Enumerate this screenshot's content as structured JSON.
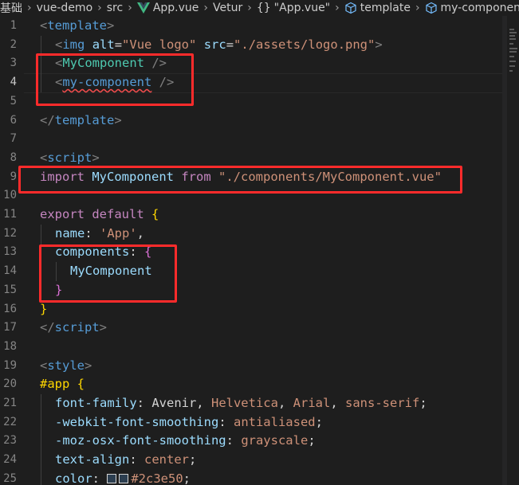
{
  "breadcrumb": {
    "items": [
      {
        "label": "基础",
        "icon": null
      },
      {
        "label": "vue-demo",
        "icon": null
      },
      {
        "label": "src",
        "icon": null
      },
      {
        "label": "App.vue",
        "icon": "vue-icon"
      },
      {
        "label": "Vetur",
        "icon": null
      },
      {
        "label": "\"App.vue\"",
        "icon": "braces-icon"
      },
      {
        "label": "template",
        "icon": "cube-icon"
      },
      {
        "label": "my-component",
        "icon": "cube-icon"
      }
    ],
    "separator": "›"
  },
  "editor": {
    "active_line": 4,
    "lines": [
      {
        "n": "1",
        "indent": 0,
        "tokens": [
          [
            "t-punc",
            "<"
          ],
          [
            "t-tag",
            "template"
          ],
          [
            "t-punc",
            ">"
          ]
        ]
      },
      {
        "n": "2",
        "indent": 1,
        "tokens": [
          [
            "t-punc",
            "<"
          ],
          [
            "t-tag",
            "img"
          ],
          [
            "t-text",
            " "
          ],
          [
            "t-attr",
            "alt"
          ],
          [
            "t-text",
            "="
          ],
          [
            "t-str",
            "\"Vue logo\""
          ],
          [
            "t-text",
            " "
          ],
          [
            "t-attr",
            "src"
          ],
          [
            "t-text",
            "="
          ],
          [
            "t-str",
            "\"./assets/logo.png\""
          ],
          [
            "t-punc",
            ">"
          ]
        ]
      },
      {
        "n": "3",
        "indent": 1,
        "tokens": [
          [
            "t-punc",
            "<"
          ],
          [
            "t-comp",
            "MyComponent"
          ],
          [
            "t-text",
            " "
          ],
          [
            "t-punc",
            "/>"
          ]
        ]
      },
      {
        "n": "4",
        "indent": 1,
        "tokens": [
          [
            "t-punc",
            "<"
          ],
          [
            "t-tag squiggle",
            "my-component"
          ],
          [
            "t-text",
            " "
          ],
          [
            "t-punc",
            "/>"
          ]
        ]
      },
      {
        "n": "5",
        "indent": 0,
        "tokens": []
      },
      {
        "n": "6",
        "indent": 0,
        "tokens": [
          [
            "t-punc",
            "</"
          ],
          [
            "t-tag",
            "template"
          ],
          [
            "t-punc",
            ">"
          ]
        ]
      },
      {
        "n": "7",
        "indent": 0,
        "tokens": []
      },
      {
        "n": "8",
        "indent": 0,
        "tokens": [
          [
            "t-punc",
            "<"
          ],
          [
            "t-tag",
            "script"
          ],
          [
            "t-punc",
            ">"
          ]
        ]
      },
      {
        "n": "9",
        "indent": 0,
        "tokens": [
          [
            "t-kw",
            "import"
          ],
          [
            "t-text",
            " "
          ],
          [
            "t-var",
            "MyComponent"
          ],
          [
            "t-text",
            " "
          ],
          [
            "t-kw",
            "from"
          ],
          [
            "t-text",
            " "
          ],
          [
            "t-str",
            "\"./components/MyComponent.vue\""
          ]
        ]
      },
      {
        "n": "10",
        "indent": 0,
        "tokens": []
      },
      {
        "n": "11",
        "indent": 0,
        "tokens": [
          [
            "t-kw",
            "export"
          ],
          [
            "t-text",
            " "
          ],
          [
            "t-kw",
            "default"
          ],
          [
            "t-text",
            " "
          ],
          [
            "t-brace1",
            "{"
          ]
        ]
      },
      {
        "n": "12",
        "indent": 1,
        "tokens": [
          [
            "t-var",
            "name"
          ],
          [
            "t-text",
            ": "
          ],
          [
            "t-str",
            "'App'"
          ],
          [
            "t-text",
            ","
          ]
        ]
      },
      {
        "n": "13",
        "indent": 1,
        "tokens": [
          [
            "t-var",
            "components"
          ],
          [
            "t-text",
            ": "
          ],
          [
            "t-brace2",
            "{"
          ]
        ]
      },
      {
        "n": "14",
        "indent": 2,
        "tokens": [
          [
            "t-var",
            "MyComponent"
          ]
        ]
      },
      {
        "n": "15",
        "indent": 1,
        "tokens": [
          [
            "t-brace2",
            "}"
          ]
        ]
      },
      {
        "n": "16",
        "indent": 0,
        "tokens": [
          [
            "t-brace1",
            "}"
          ]
        ]
      },
      {
        "n": "17",
        "indent": 0,
        "tokens": [
          [
            "t-punc",
            "</"
          ],
          [
            "t-tag",
            "script"
          ],
          [
            "t-punc",
            ">"
          ]
        ]
      },
      {
        "n": "18",
        "indent": 0,
        "tokens": []
      },
      {
        "n": "19",
        "indent": 0,
        "tokens": [
          [
            "t-punc",
            "<"
          ],
          [
            "t-tag",
            "style"
          ],
          [
            "t-punc",
            ">"
          ]
        ]
      },
      {
        "n": "20",
        "indent": 0,
        "tokens": [
          [
            "t-brace1",
            "#app"
          ],
          [
            "t-text",
            " "
          ],
          [
            "t-brace1",
            "{"
          ]
        ]
      },
      {
        "n": "21",
        "indent": 1,
        "tokens": [
          [
            "t-var",
            "font-family"
          ],
          [
            "t-text",
            ": Avenir, "
          ],
          [
            "t-str",
            "Helvetica"
          ],
          [
            "t-text",
            ", "
          ],
          [
            "t-str",
            "Arial"
          ],
          [
            "t-text",
            ", "
          ],
          [
            "t-str",
            "sans-serif"
          ],
          [
            "t-text",
            ";"
          ]
        ]
      },
      {
        "n": "22",
        "indent": 1,
        "tokens": [
          [
            "t-var",
            "-webkit-font-smoothing"
          ],
          [
            "t-text",
            ": "
          ],
          [
            "t-str",
            "antialiased"
          ],
          [
            "t-text",
            ";"
          ]
        ]
      },
      {
        "n": "23",
        "indent": 1,
        "tokens": [
          [
            "t-var",
            "-moz-osx-font-smoothing"
          ],
          [
            "t-text",
            ": "
          ],
          [
            "t-str",
            "grayscale"
          ],
          [
            "t-text",
            ";"
          ]
        ]
      },
      {
        "n": "24",
        "indent": 1,
        "tokens": [
          [
            "t-var",
            "text-align"
          ],
          [
            "t-text",
            ": "
          ],
          [
            "t-str",
            "center"
          ],
          [
            "t-text",
            ";"
          ]
        ]
      },
      {
        "n": "25",
        "indent": 1,
        "tokens": [
          [
            "t-var",
            "color"
          ],
          [
            "t-text",
            ": "
          ],
          [
            "swatch",
            ""
          ],
          [
            "swatch",
            ""
          ],
          [
            "t-str",
            "#2c3e50"
          ],
          [
            "t-text",
            ";"
          ]
        ]
      }
    ],
    "highlight_color": "#ff2b2b"
  },
  "colors": {
    "background": "#1e1e1e",
    "tag": "#569cd6",
    "component": "#4ec9b0",
    "string": "#ce9178",
    "keyword": "#c586c0",
    "property": "#9cdcfe",
    "brace_outer": "#ffd700",
    "brace_inner": "#da70d6",
    "swatch_color": "#2c3e50"
  }
}
